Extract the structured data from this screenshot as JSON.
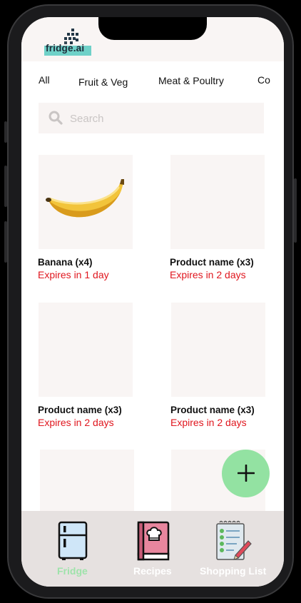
{
  "app": {
    "logo_text": "fridge.ai"
  },
  "categories": [
    {
      "label": "All"
    },
    {
      "label": "Fruit & Veg"
    },
    {
      "label": "Meat & Poultry"
    },
    {
      "label": "Co"
    }
  ],
  "search": {
    "placeholder": "Search",
    "value": ""
  },
  "products": [
    {
      "name": "Banana (x4)",
      "expiry": "Expires in 1 day",
      "image": "banana"
    },
    {
      "name": "Product name (x3)",
      "expiry": "Expires in 2 days",
      "image": ""
    },
    {
      "name": "Product name (x3)",
      "expiry": "Expires in 2 days",
      "image": ""
    },
    {
      "name": "Product name (x3)",
      "expiry": "Expires in 2 days",
      "image": ""
    },
    {
      "name": "",
      "expiry": "",
      "image": ""
    },
    {
      "name": "",
      "expiry": "",
      "image": ""
    }
  ],
  "fab": {
    "icon": "plus-icon"
  },
  "nav": [
    {
      "label": "Fridge",
      "icon": "fridge-icon",
      "active": true
    },
    {
      "label": "Recipes",
      "icon": "recipe-book-icon",
      "active": false
    },
    {
      "label": "Shopping List",
      "icon": "checklist-icon",
      "active": false
    }
  ],
  "colors": {
    "expiry": "#e0161e",
    "active_nav": "#9fe3ab",
    "fab": "#93e2a2",
    "card_bg": "#f9f5f4",
    "logo_accent": "#6fd1c8"
  }
}
